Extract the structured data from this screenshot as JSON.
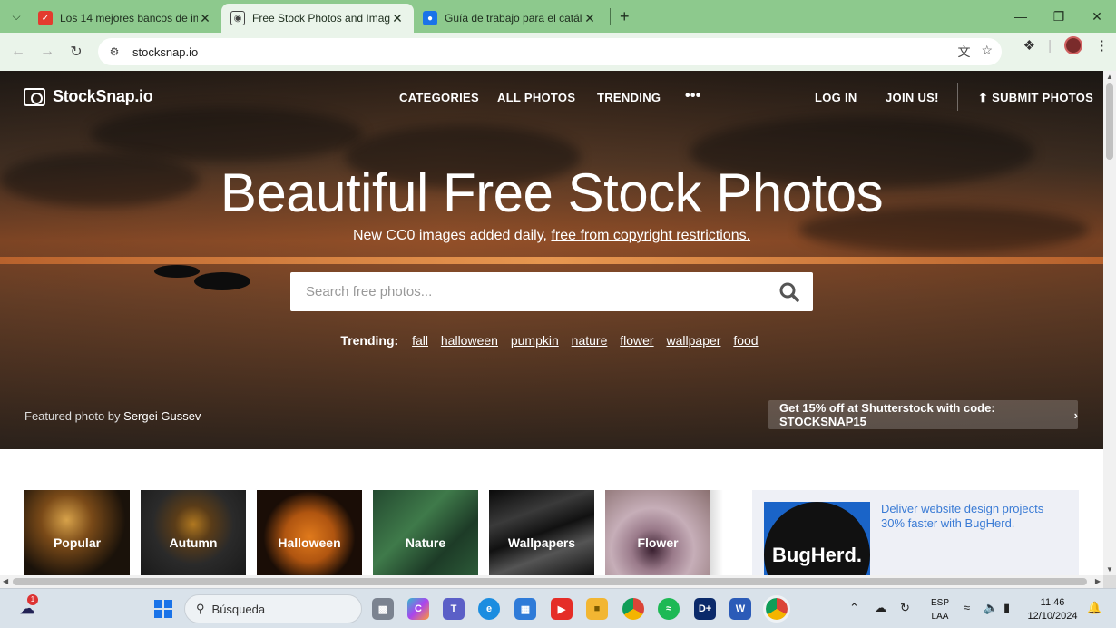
{
  "browser": {
    "tabs": [
      {
        "title": "Los 14 mejores bancos de imág",
        "active": false,
        "favicon_color": "#e33b2e"
      },
      {
        "title": "Free Stock Photos and Images -",
        "active": true,
        "favicon_color": "#444444"
      },
      {
        "title": "Guía de trabajo para el catálog",
        "active": false,
        "favicon_color": "#1a73e8"
      }
    ],
    "url": "stocksnap.io"
  },
  "site": {
    "logo": "StockSnap.io",
    "nav": {
      "categories": "CATEGORIES",
      "all_photos": "ALL PHOTOS",
      "trending": "TRENDING",
      "more": "•••",
      "login": "LOG IN",
      "join": "JOIN US!",
      "submit": "SUBMIT PHOTOS"
    },
    "hero": {
      "headline": "Beautiful Free Stock Photos",
      "sub_prefix": "New CC0 images added daily,",
      "sub_link": "free from copyright restrictions.",
      "search_placeholder": "Search free photos...",
      "trending_label": "Trending:",
      "trending_tags": [
        "fall",
        "halloween",
        "pumpkin",
        "nature",
        "flower",
        "wallpaper",
        "food"
      ],
      "featured_prefix": "Featured photo by",
      "featured_author": "Sergei Gussev",
      "promo": "Get 15% off at Shutterstock with code: STOCKSNAP15"
    },
    "categories": [
      "Popular",
      "Autumn",
      "Halloween",
      "Nature",
      "Wallpapers",
      "Flower"
    ],
    "ad": {
      "brand": "BugHerd.",
      "text": "Deliver website design projects 30% faster with BugHerd."
    }
  },
  "taskbar": {
    "search_label": "Búsqueda",
    "notification_count": "1",
    "lang_line1": "ESP",
    "lang_line2": "LAA",
    "time": "11:46",
    "date": "12/10/2024"
  }
}
